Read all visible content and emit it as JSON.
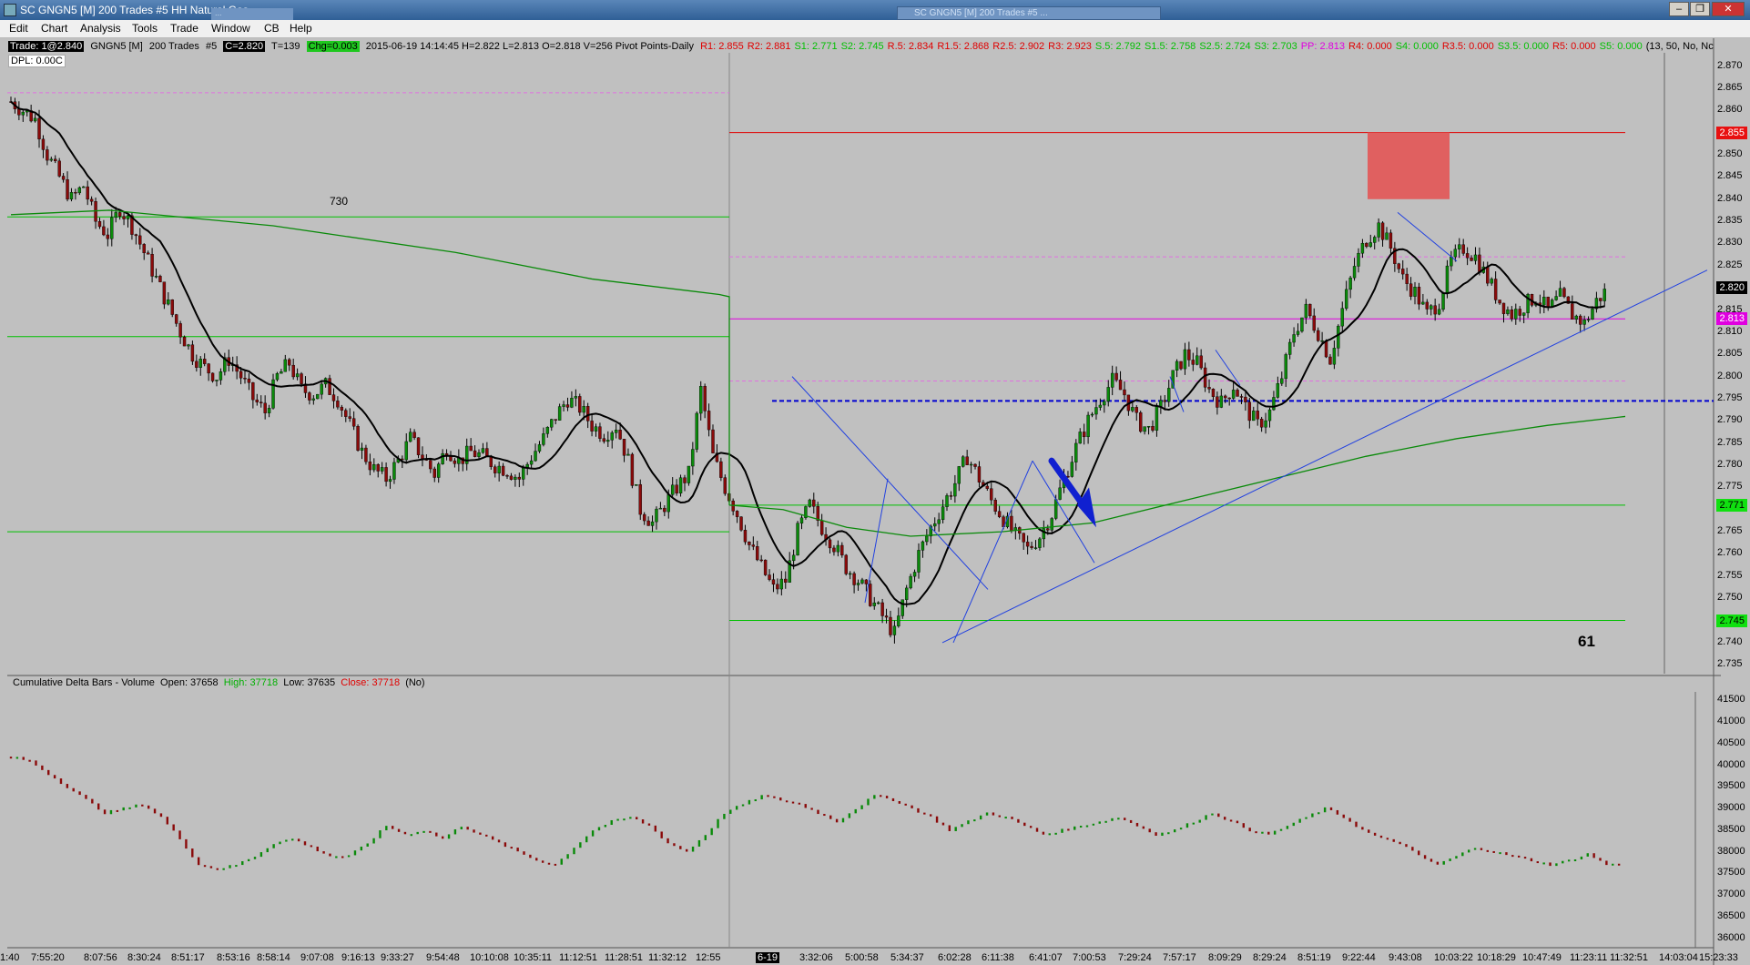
{
  "window": {
    "title": "SC GNGN5 [M]  200 Trades  #5  HH Natural Gas",
    "ghost_title": "SC GNGN5 [M] 200 Trades #5 ...",
    "ghost_title2": "...",
    "minimize": "–",
    "restore": "❐",
    "close": "✕"
  },
  "menu": [
    "Edit",
    "Chart",
    "Analysis",
    "Tools",
    "Trade",
    "Window",
    "CB",
    "Help"
  ],
  "info_bar": {
    "trade": "Trade: 1@2.840",
    "symbol": "GNGN5 [M]",
    "bars": "200 Trades",
    "num": "#5",
    "close": "C=2.820",
    "trades": "T=139",
    "chg": "Chg=0.003",
    "stats": "2015-06-19 14:14:45 H=2.822 L=2.813 O=2.818 V=256 Pivot Points-Daily",
    "pivots": [
      {
        "label": "R1: 2.855",
        "color": "#e00000"
      },
      {
        "label": "R2: 2.881",
        "color": "#e00000"
      },
      {
        "label": "S1: 2.771",
        "color": "#00c000"
      },
      {
        "label": "S2: 2.745",
        "color": "#00c000"
      },
      {
        "label": "R.5: 2.834",
        "color": "#e00000"
      },
      {
        "label": "R1.5: 2.868",
        "color": "#e00000"
      },
      {
        "label": "R2.5: 2.902",
        "color": "#e00000"
      },
      {
        "label": "R3: 2.923",
        "color": "#e00000"
      },
      {
        "label": "S.5: 2.792",
        "color": "#00c000"
      },
      {
        "label": "S1.5: 2.758",
        "color": "#00c000"
      },
      {
        "label": "S2.5: 2.724",
        "color": "#00c000"
      },
      {
        "label": "S3: 2.703",
        "color": "#00c000"
      },
      {
        "label": "PP: 2.813",
        "color": "#e000e0"
      },
      {
        "label": "R4: 0.000",
        "color": "#e00000"
      },
      {
        "label": "S4: 0.000",
        "color": "#00c000"
      },
      {
        "label": "R3.5: 0.000",
        "color": "#e00000"
      },
      {
        "label": "S3.5: 0.000",
        "color": "#00c000"
      },
      {
        "label": "R5: 0.000",
        "color": "#e00000"
      },
      {
        "label": "S5: 0.000",
        "color": "#00c000"
      },
      {
        "label": "(13, 50, No, Nc",
        "color": "#000000"
      }
    ]
  },
  "dpl": "DPL: 0.00C",
  "lower_panel": {
    "title": "Cumulative Delta Bars - Volume",
    "open": "Open: 37658",
    "high": "High: 37718",
    "low": "Low: 37635",
    "close": "Close: 37718",
    "flag": "(No)"
  },
  "annotations": {
    "a730": "730",
    "a61": "61"
  },
  "price_labels": [
    {
      "text": "2.855",
      "bg": "#e81010",
      "fg": "#ffffff",
      "value": 2.855
    },
    {
      "text": "2.820",
      "bg": "#000000",
      "fg": "#ffffff",
      "value": 2.82
    },
    {
      "text": "2.813",
      "bg": "#e000e0",
      "fg": "#ffffff",
      "value": 2.813
    },
    {
      "text": "2.771",
      "bg": "#10e010",
      "fg": "#000000",
      "value": 2.771
    },
    {
      "text": "2.745",
      "bg": "#10e010",
      "fg": "#000000",
      "value": 2.745
    }
  ],
  "y_ticks": [
    "2.870",
    "2.865",
    "2.860",
    "2.850",
    "2.845",
    "2.840",
    "2.835",
    "2.830",
    "2.825",
    "2.815",
    "2.810",
    "2.805",
    "2.800",
    "2.795",
    "2.790",
    "2.785",
    "2.780",
    "2.775",
    "2.765",
    "2.760",
    "2.755",
    "2.750",
    "2.740",
    "2.735"
  ],
  "y_ticks_lower": [
    "41500",
    "41000",
    "40500",
    "40000",
    "39500",
    "39000",
    "38500",
    "38000",
    "37500",
    "37000",
    "36500",
    "36000"
  ],
  "x_ticks": [
    "1:40",
    "7:55:20",
    "8:07:56",
    "8:30:24",
    "8:51:17",
    "8:53:16",
    "8:58:14",
    "9:07:08",
    "9:16:13",
    "9:33:27",
    "9:54:48",
    "10:10:08",
    "10:35:11",
    "11:12:51",
    "11:28:51",
    "11:32:12",
    "12:55",
    "6-19",
    "3:32:06",
    "5:00:58",
    "5:34:37",
    "6:02:28",
    "6:11:38",
    "6:41:07",
    "7:00:53",
    "7:29:24",
    "7:57:17",
    "8:09:29",
    "8:29:24",
    "8:51:19",
    "9:22:44",
    "9:43:08",
    "10:03:22",
    "10:18:29",
    "10:47:49",
    "11:23:11",
    "11:32:51",
    "14:03:04",
    "15:23:33"
  ],
  "chart_data": {
    "type": "candlestick",
    "y_range": [
      2.733,
      2.873
    ],
    "lower_range": [
      35800,
      41700
    ],
    "session_split_label": "6-19",
    "levels": [
      {
        "name": "R1",
        "value": 2.855,
        "color": "#e00000"
      },
      {
        "name": "PP",
        "value": 2.813,
        "color": "#e000e0"
      },
      {
        "name": "S1",
        "value": 2.771,
        "color": "#00c000"
      },
      {
        "name": "S2",
        "value": 2.745,
        "color": "#00c000"
      },
      {
        "name": "S.5",
        "value": 2.792,
        "color": "#0000c0"
      },
      {
        "name": "prev R1",
        "value": 2.836,
        "color": "#00c000"
      },
      {
        "name": "prev PP",
        "value": 2.809,
        "color": "#00c000"
      },
      {
        "name": "prev S1",
        "value": 2.765,
        "color": "#00c000"
      }
    ],
    "close_path": [
      2.862,
      2.86,
      2.858,
      2.85,
      2.845,
      2.84,
      2.843,
      2.835,
      2.832,
      2.838,
      2.834,
      2.828,
      2.822,
      2.816,
      2.81,
      2.805,
      2.802,
      2.8,
      2.804,
      2.8,
      2.795,
      2.792,
      2.8,
      2.803,
      2.797,
      2.796,
      2.798,
      2.795,
      2.789,
      2.783,
      2.779,
      2.777,
      2.781,
      2.786,
      2.782,
      2.778,
      2.784,
      2.781,
      2.783,
      2.782,
      2.78,
      2.779,
      2.777,
      2.782,
      2.786,
      2.791,
      2.795,
      2.793,
      2.789,
      2.787,
      2.789,
      2.781,
      2.77,
      2.767,
      2.771,
      2.775,
      2.778,
      2.797,
      2.782,
      2.775,
      2.769,
      2.762,
      2.757,
      2.752,
      2.754,
      2.765,
      2.771,
      2.766,
      2.762,
      2.757,
      2.754,
      2.75,
      2.746,
      2.742,
      2.752,
      2.76,
      2.766,
      2.771,
      2.776,
      2.782,
      2.777,
      2.772,
      2.768,
      2.764,
      2.761,
      2.764,
      2.769,
      2.777,
      2.784,
      2.79,
      2.795,
      2.799,
      2.796,
      2.79,
      2.788,
      2.793,
      2.8,
      2.805,
      2.803,
      2.797,
      2.794,
      2.798,
      2.793,
      2.789,
      2.792,
      2.8,
      2.81,
      2.815,
      2.81,
      2.804,
      2.815,
      2.825,
      2.831,
      2.834,
      2.829,
      2.822,
      2.819,
      2.814,
      2.817,
      2.826,
      2.829,
      2.827,
      2.822,
      2.817,
      2.814,
      2.816,
      2.818,
      2.815,
      2.818,
      2.814,
      2.812,
      2.817,
      2.82
    ],
    "delta_path": [
      40200,
      40100,
      39800,
      39500,
      39200,
      38900,
      39000,
      39100,
      38800,
      38300,
      37700,
      37600,
      37700,
      37900,
      38200,
      38300,
      38100,
      37900,
      37900,
      38200,
      38600,
      38400,
      38500,
      38300,
      38600,
      38400,
      38200,
      38000,
      37800,
      37700,
      38100,
      38500,
      38700,
      38800,
      38600,
      38200,
      38000,
      38400,
      38900,
      39100,
      39300,
      39200,
      39100,
      38900,
      38700,
      39000,
      39300,
      39200,
      39000,
      38800,
      38500,
      38700,
      38900,
      38800,
      38600,
      38400,
      38500,
      38600,
      38700,
      38800,
      38600,
      38400,
      38500,
      38700,
      38900,
      38700,
      38500,
      38400,
      38600,
      38800,
      39000,
      38800,
      38500,
      38300,
      38200,
      37900,
      37700,
      37900,
      38100,
      38000,
      37900,
      37800,
      37700,
      37800,
      37950,
      37700,
      37718
    ],
    "moving_avg_fast": "black",
    "moving_avg_slow": "green"
  }
}
